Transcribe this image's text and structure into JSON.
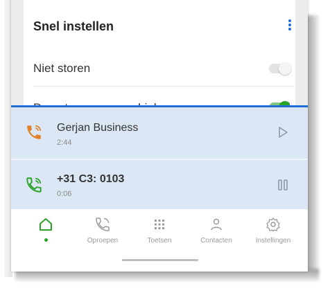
{
  "quick_settings": {
    "title": "Snel instellen",
    "menu_icon": "more-vertical-icon",
    "do_not_disturb": {
      "label": "Niet storen",
      "enabled": false
    },
    "forward_to_mobile": {
      "label": "Doorsturen naar mobiel",
      "enabled": true
    }
  },
  "calls": [
    {
      "name": "Gerjan Business",
      "duration": "2:44",
      "icon": "call-held-icon",
      "icon_color": "#e0832b",
      "action_icon": "play-icon"
    },
    {
      "name": "+31 C3: 0103",
      "duration": "0:06",
      "icon": "call-active-icon",
      "icon_color": "#2aa22a",
      "action_icon": "pause-icon"
    }
  ],
  "nav": [
    {
      "label": "",
      "icon": "home-icon",
      "active": true
    },
    {
      "label": "Oproepen",
      "icon": "phone-icon",
      "active": false
    },
    {
      "label": "Toetsen",
      "icon": "dialpad-icon",
      "active": false
    },
    {
      "label": "Contacten",
      "icon": "person-icon",
      "active": false
    },
    {
      "label": "Instellingen",
      "icon": "settings-icon",
      "active": false
    }
  ],
  "colors": {
    "accent": "#1f6fd6",
    "active_green": "#2aa22a",
    "held_orange": "#e0832b",
    "calls_panel_bg": "#dbe7f5"
  }
}
